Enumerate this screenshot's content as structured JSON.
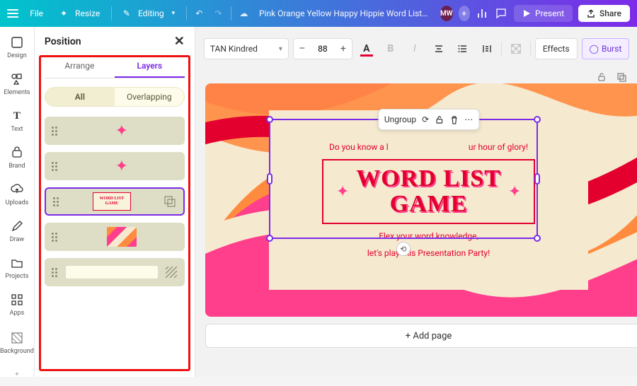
{
  "topbar": {
    "file": "File",
    "resize": "Resize",
    "editing": "Editing",
    "title": "Pink Orange Yellow Happy Hippie Word List Game ...",
    "avatar": "MW",
    "present": "Present",
    "share": "Share"
  },
  "rail": {
    "items": [
      {
        "key": "design",
        "label": "Design"
      },
      {
        "key": "elements",
        "label": "Elements"
      },
      {
        "key": "text",
        "label": "Text"
      },
      {
        "key": "brand",
        "label": "Brand"
      },
      {
        "key": "uploads",
        "label": "Uploads"
      },
      {
        "key": "draw",
        "label": "Draw"
      },
      {
        "key": "projects",
        "label": "Projects"
      },
      {
        "key": "apps",
        "label": "Apps"
      }
    ],
    "background": "Background"
  },
  "panel": {
    "title": "Position",
    "tabs": {
      "arrange": "Arrange",
      "layers": "Layers"
    },
    "filter": {
      "all": "All",
      "overlapping": "Overlapping"
    },
    "layer3_text": "WORD LIST\nGAME"
  },
  "toolbar": {
    "font": "TAN Kindred",
    "size": "88",
    "effects": "Effects",
    "burst": "Burst"
  },
  "context": {
    "ungroup": "Ungroup"
  },
  "canvas": {
    "line1": "Do you know a lot of words? This is your hour of glory!",
    "line1_left": "Do you know a l",
    "line1_right": "ur hour of glory!",
    "title": "WORD LIST\nGAME",
    "line2": "Flex your word knowledge,",
    "line3": "let's play this Presentation Party!"
  },
  "addpage": "+ Add page",
  "colors": {
    "accent": "#7d2ae8",
    "red": "#e3002f",
    "pink": "#ff3e8c",
    "orange": "#ff8b3e",
    "cream": "#f5e9cf"
  }
}
